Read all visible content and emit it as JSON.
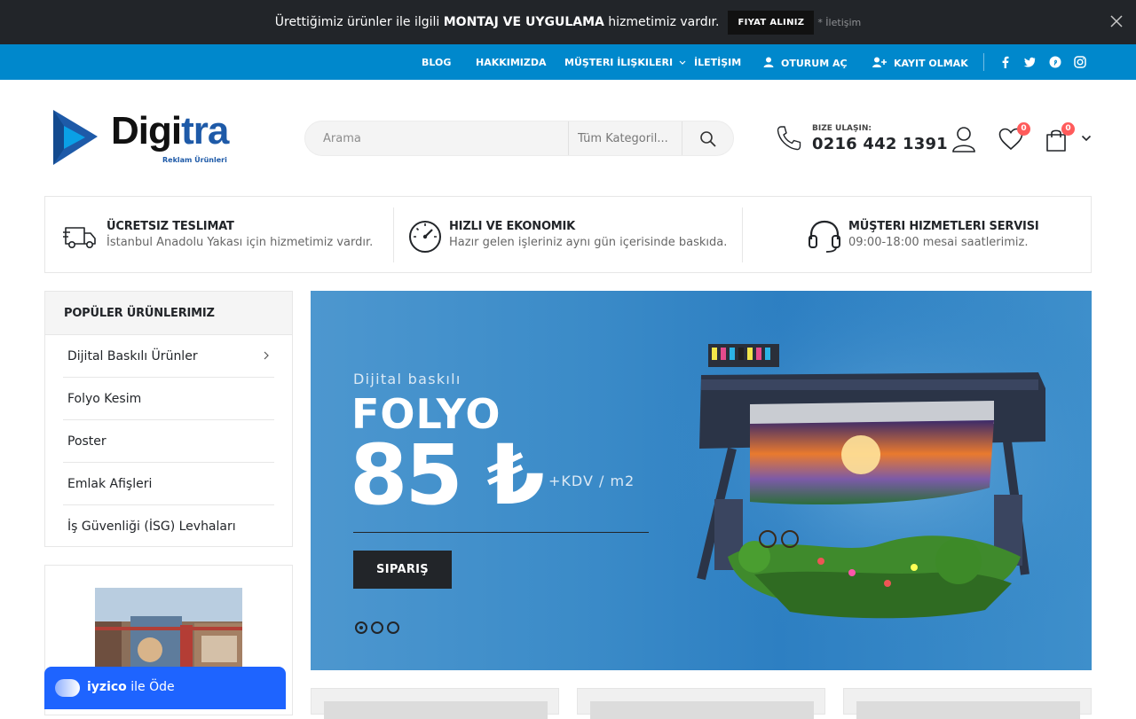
{
  "announcement": {
    "text_before": "Ürettiğimiz ürünler ile ilgili ",
    "text_bold": "MONTAJ VE UYGULAMA",
    "text_after": " hizmetimiz vardır.",
    "button": "FIYAT ALINIZ",
    "contact": "* İletişim"
  },
  "nav": {
    "blog": "BLOG",
    "about": "HAKKIMIZDA",
    "relations": "MÜŞTERI İLIŞKILERI",
    "contact": "İLETİŞIM",
    "login": "OTURUM AÇ",
    "register": "KAYIT OLMAK"
  },
  "logo": {
    "word_a": "Digi",
    "word_b": "tra",
    "tagline": "Reklam Ürünleri"
  },
  "search": {
    "placeholder": "Arama",
    "category": "Tüm Kategoril..."
  },
  "phone": {
    "label": "BIZE ULAŞIN:",
    "number": "0216 442 1391"
  },
  "badges": {
    "wishlist": "0",
    "cart": "0"
  },
  "features": [
    {
      "title": "ÜCRETSIZ TESLIMAT",
      "desc": "İstanbul Anadolu Yakası için hizmetimiz vardır."
    },
    {
      "title": "HIZLI VE EKONOMIK",
      "desc": "Hazır gelen işleriniz aynı gün içerisinde baskıda."
    },
    {
      "title": "MÜŞTERI HIZMETLERI SERVISI",
      "desc": "09:00-18:00 mesai saatlerimiz."
    }
  ],
  "sidebar": {
    "title": "POPÜLER ÜRÜNLERIMIZ",
    "items": [
      "Dijital Baskılı Ürünler",
      "Folyo Kesim",
      "Poster",
      "Emlak Afişleri",
      "İş Güvenliği (İSG) Levhaları"
    ]
  },
  "hero": {
    "subtitle": "Dijital baskılı",
    "headline": "FOLYO",
    "price": "85 ₺",
    "price_note": "+KDV / m2",
    "button": "SIPARIŞ",
    "slide_count": 3,
    "active_slide": 1
  },
  "payment": {
    "brand": "iyzico",
    "text": " ile Öde"
  },
  "colors": {
    "topbar": "#222529",
    "nav": "#0088cc",
    "hero": "#3b8bc8",
    "badge": "#ff5b5b",
    "iyzico": "#1e64ff"
  }
}
